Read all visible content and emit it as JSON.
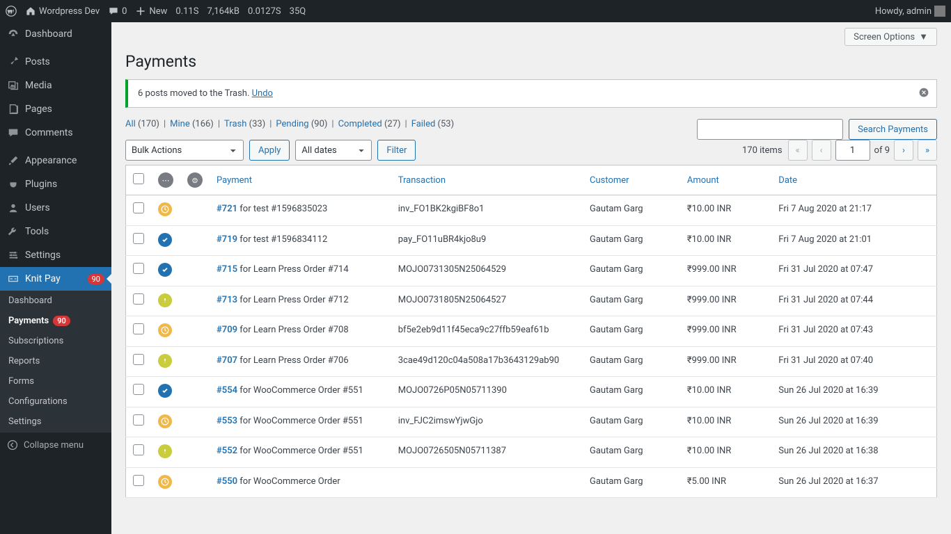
{
  "adminbar": {
    "site_name": "Wordpress Dev",
    "comments": "0",
    "new": "New",
    "debug1": "0.11S",
    "debug2": "7,164kB",
    "debug3": "0.0127S",
    "debug4": "35Q",
    "howdy": "Howdy, admin"
  },
  "sidebar": {
    "items": [
      {
        "label": "Dashboard",
        "icon": "dashboard"
      },
      {
        "label": "Posts",
        "icon": "pin"
      },
      {
        "label": "Media",
        "icon": "media"
      },
      {
        "label": "Pages",
        "icon": "pages"
      },
      {
        "label": "Comments",
        "icon": "comment"
      },
      {
        "label": "Appearance",
        "icon": "brush"
      },
      {
        "label": "Plugins",
        "icon": "plug"
      },
      {
        "label": "Users",
        "icon": "user"
      },
      {
        "label": "Tools",
        "icon": "wrench"
      },
      {
        "label": "Settings",
        "icon": "sliders"
      },
      {
        "label": "Knit Pay",
        "icon": "knitpay",
        "badge": "90",
        "active": true
      }
    ],
    "submenu": [
      {
        "label": "Dashboard"
      },
      {
        "label": "Payments",
        "active": true,
        "badge": "90"
      },
      {
        "label": "Subscriptions"
      },
      {
        "label": "Reports"
      },
      {
        "label": "Forms"
      },
      {
        "label": "Configurations"
      },
      {
        "label": "Settings"
      }
    ],
    "collapse": "Collapse menu"
  },
  "page": {
    "title": "Payments",
    "screen_options": "Screen Options",
    "notice_text": "6 posts moved to the Trash. ",
    "notice_undo": "Undo"
  },
  "filters": {
    "views": [
      {
        "label": "All",
        "count": "(170)"
      },
      {
        "label": "Mine",
        "count": "(166)"
      },
      {
        "label": "Trash",
        "count": "(33)"
      },
      {
        "label": "Pending",
        "count": "(90)"
      },
      {
        "label": "Completed",
        "count": "(27)"
      },
      {
        "label": "Failed",
        "count": "(53)"
      }
    ],
    "search_button": "Search Payments",
    "bulk_label": "Bulk Actions",
    "apply": "Apply",
    "dates_label": "All dates",
    "filter": "Filter",
    "items_count": "170 items",
    "page_current": "1",
    "page_total": "of 9"
  },
  "table": {
    "headers": {
      "payment": "Payment",
      "transaction": "Transaction",
      "customer": "Customer",
      "amount": "Amount",
      "date": "Date"
    },
    "rows": [
      {
        "status": "pending",
        "id": "#721",
        "desc": " for test #1596835023",
        "txn": "inv_FO1BK2kgiBF8o1",
        "customer": "Gautam Garg",
        "amount": "₹10.00 INR",
        "date": "Fri 7 Aug 2020 at 21:17"
      },
      {
        "status": "success",
        "id": "#719",
        "desc": " for test #1596834112",
        "txn": "pay_FO11uBR4kjo8u9",
        "customer": "Gautam Garg",
        "amount": "₹10.00 INR",
        "date": "Fri 7 Aug 2020 at 21:01"
      },
      {
        "status": "success",
        "id": "#715",
        "desc": " for Learn Press Order #714",
        "txn": "MOJO0731305N25064529",
        "customer": "Gautam Garg",
        "amount": "₹999.00 INR",
        "date": "Fri 31 Jul 2020 at 07:47"
      },
      {
        "status": "warn",
        "id": "#713",
        "desc": " for Learn Press Order #712",
        "txn": "MOJO0731805N25064527",
        "customer": "Gautam Garg",
        "amount": "₹999.00 INR",
        "date": "Fri 31 Jul 2020 at 07:44"
      },
      {
        "status": "pending",
        "id": "#709",
        "desc": " for Learn Press Order #708",
        "txn": "bf5e2eb9d11f45eca9c27ffb59eaf61b",
        "customer": "Gautam Garg",
        "amount": "₹999.00 INR",
        "date": "Fri 31 Jul 2020 at 07:43"
      },
      {
        "status": "warn",
        "id": "#707",
        "desc": " for Learn Press Order #706",
        "txn": "3cae49d120c04a508a17b3643129ab90",
        "customer": "Gautam Garg",
        "amount": "₹999.00 INR",
        "date": "Fri 31 Jul 2020 at 07:40"
      },
      {
        "status": "success",
        "id": "#554",
        "desc": " for WooCommerce Order #551",
        "txn": "MOJO0726P05N05711390",
        "customer": "Gautam Garg",
        "amount": "₹10.00 INR",
        "date": "Sun 26 Jul 2020 at 16:39"
      },
      {
        "status": "pending",
        "id": "#553",
        "desc": " for WooCommerce Order #551",
        "txn": "inv_FJC2imswYjwGjo",
        "customer": "Gautam Garg",
        "amount": "₹10.00 INR",
        "date": "Sun 26 Jul 2020 at 16:39"
      },
      {
        "status": "warn",
        "id": "#552",
        "desc": " for WooCommerce Order #551",
        "txn": "MOJO0726505N05711387",
        "customer": "Gautam Garg",
        "amount": "₹10.00 INR",
        "date": "Sun 26 Jul 2020 at 16:38"
      },
      {
        "status": "pending",
        "id": "#550",
        "desc": " for WooCommerce Order",
        "txn": "",
        "customer": "Gautam Garg",
        "amount": "₹5.00 INR",
        "date": "Sun 26 Jul 2020 at 16:37"
      }
    ]
  }
}
